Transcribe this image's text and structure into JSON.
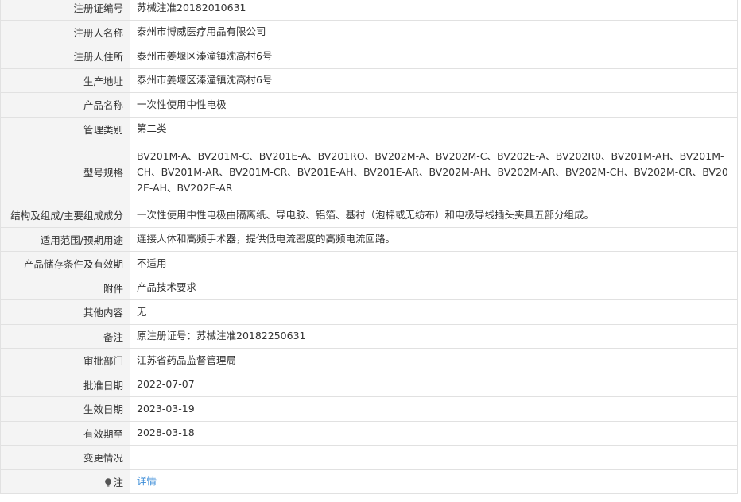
{
  "rows": [
    {
      "label": "注册证编号",
      "value": "苏械注准20182010631"
    },
    {
      "label": "注册人名称",
      "value": "泰州市博威医疗用品有限公司"
    },
    {
      "label": "注册人住所",
      "value": "泰州市姜堰区溱潼镇沈高村6号"
    },
    {
      "label": "生产地址",
      "value": "泰州市姜堰区溱潼镇沈高村6号"
    },
    {
      "label": "产品名称",
      "value": "一次性使用中性电极"
    },
    {
      "label": "管理类别",
      "value": "第二类"
    },
    {
      "label": "型号规格",
      "value": "BV201M-A、BV201M-C、BV201E-A、BV201RO、BV202M-A、BV202M-C、BV202E-A、BV202R0、BV201M-AH、BV201M-CH、BV201M-AR、BV201M-CR、BV201E-AH、BV201E-AR、BV202M-AH、BV202M-AR、BV202M-CH、BV202M-CR、BV202E-AH、BV202E-AR"
    },
    {
      "label": "结构及组成/主要组成成分",
      "value": "一次性使用中性电极由隔离纸、导电胶、铝箔、基衬（泡棉或无纺布）和电极导线插头夹具五部分组成。"
    },
    {
      "label": "适用范围/预期用途",
      "value": "连接人体和高频手术器，提供低电流密度的高频电流回路。"
    },
    {
      "label": "产品储存条件及有效期",
      "value": "不适用"
    },
    {
      "label": "附件",
      "value": "产品技术要求"
    },
    {
      "label": "其他内容",
      "value": "无"
    },
    {
      "label": "备注",
      "value": "原注册证号：苏械注准20182250631"
    },
    {
      "label": "审批部门",
      "value": "江苏省药品监督管理局"
    },
    {
      "label": "批准日期",
      "value": "2022-07-07"
    },
    {
      "label": "生效日期",
      "value": "2023-03-19"
    },
    {
      "label": "有效期至",
      "value": "2028-03-18"
    },
    {
      "label": "变更情况",
      "value": ""
    }
  ],
  "note": {
    "label": "注",
    "link_text": "详情",
    "icon": "lightbulb-icon"
  }
}
